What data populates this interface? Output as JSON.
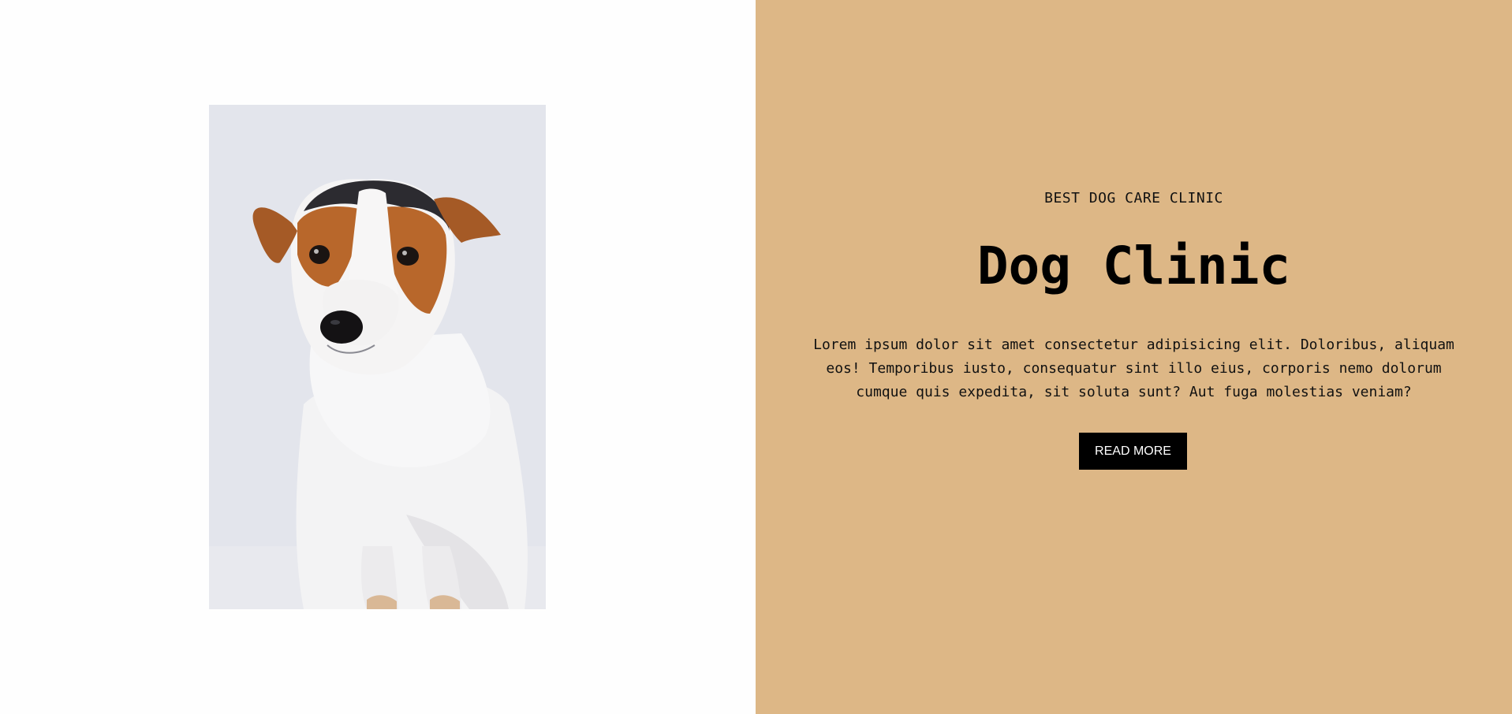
{
  "hero": {
    "image_alt": "Jack Russell terrier dog",
    "eyebrow": "BEST DOG CARE CLINIC",
    "title": "Dog Clinic",
    "description": "Lorem ipsum dolor sit amet consectetur adipisicing elit. Doloribus, aliquam eos! Temporibus iusto, consequatur sint illo eius, corporis nemo dolorum cumque quis expedita, sit soluta sunt? Aut fuga molestias veniam?",
    "button_label": "READ MORE"
  },
  "colors": {
    "accent_panel": "#ddb786",
    "button_bg": "#000000",
    "button_text": "#ffffff"
  }
}
